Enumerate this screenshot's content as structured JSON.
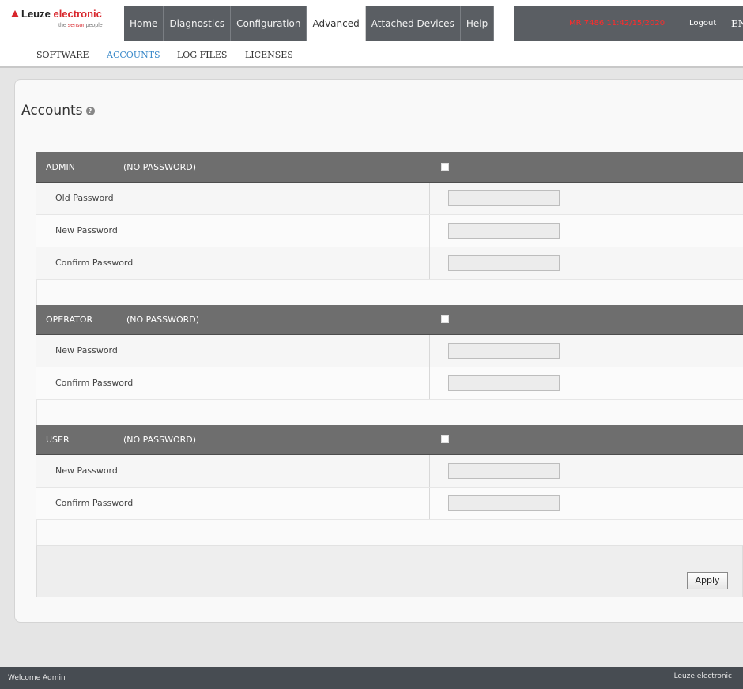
{
  "logo": {
    "brand_part1": "Leuze ",
    "brand_part2": "electronic",
    "tagline_pre": "the ",
    "tagline_red": "sensor",
    "tagline_post": " people"
  },
  "nav": {
    "tabs": [
      {
        "label": "Home"
      },
      {
        "label": "Diagnostics"
      },
      {
        "label": "Configuration"
      },
      {
        "label": "Advanced",
        "active": true
      },
      {
        "label": "Attached Devices"
      },
      {
        "label": "Help"
      }
    ],
    "device_info": "MR 7486 11:42/15/2020",
    "logout": "Logout",
    "language": "EN"
  },
  "subnav": {
    "items": [
      {
        "label": "SOFTWARE"
      },
      {
        "label": "ACCOUNTS",
        "active": true
      },
      {
        "label": "LOG FILES"
      },
      {
        "label": "LICENSES"
      }
    ]
  },
  "page": {
    "title": "Accounts",
    "help_icon": "?"
  },
  "sections": [
    {
      "name": "ADMIN",
      "status": "(NO PASSWORD)",
      "checked": false,
      "fields": [
        {
          "label": "Old Password",
          "value": ""
        },
        {
          "label": "New Password",
          "value": ""
        },
        {
          "label": "Confirm Password",
          "value": ""
        }
      ]
    },
    {
      "name": "OPERATOR",
      "status": "(NO PASSWORD)",
      "checked": false,
      "fields": [
        {
          "label": "New Password",
          "value": ""
        },
        {
          "label": "Confirm Password",
          "value": ""
        }
      ]
    },
    {
      "name": "USER",
      "status": "(NO PASSWORD)",
      "checked": false,
      "fields": [
        {
          "label": "New Password",
          "value": ""
        },
        {
          "label": "Confirm Password",
          "value": ""
        }
      ]
    }
  ],
  "apply_label": "Apply",
  "footer": {
    "welcome": "Welcome Admin",
    "brand": "Leuze electronic"
  },
  "colors": {
    "nav_bg": "#5a5e63",
    "accent_red": "#d8262c",
    "active_link": "#3a89c9",
    "section_header": "#6e6e6e",
    "footer_bg": "#474c52"
  }
}
